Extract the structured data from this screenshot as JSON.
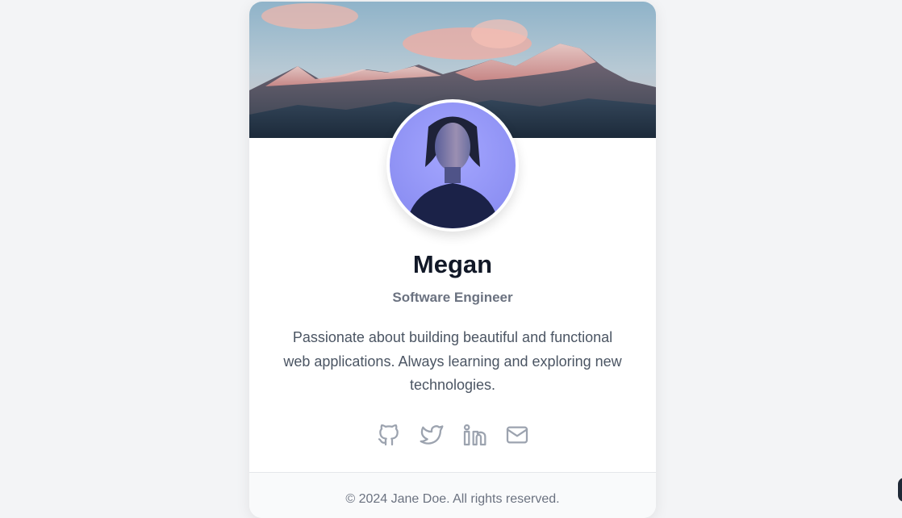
{
  "profile": {
    "name": "Megan",
    "role": "Software Engineer",
    "bio": "Passionate about building beautiful and functional web applications. Always learning and exploring new technologies.",
    "cover_image": "mountain-landscape",
    "avatar_image": "portrait-photo"
  },
  "socials": [
    {
      "icon": "github-icon",
      "label": "GitHub"
    },
    {
      "icon": "twitter-icon",
      "label": "Twitter"
    },
    {
      "icon": "linkedin-icon",
      "label": "LinkedIn"
    },
    {
      "icon": "mail-icon",
      "label": "Email"
    }
  ],
  "footer": {
    "text": "© 2024 Jane Doe. All rights reserved."
  },
  "colors": {
    "page_bg": "#f3f4f6",
    "card_bg": "#ffffff",
    "name": "#111827",
    "muted": "#6b7280",
    "icon": "#9ca3af"
  }
}
